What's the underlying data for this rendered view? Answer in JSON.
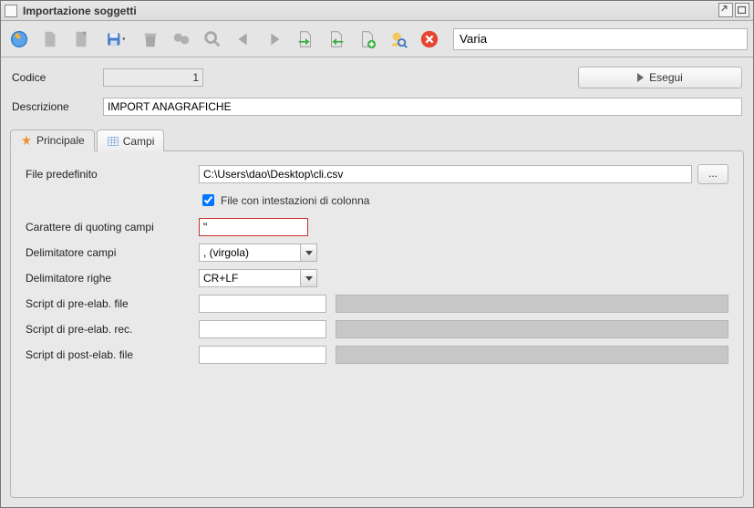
{
  "window": {
    "title": "Importazione soggetti"
  },
  "toolbar": {
    "search_value": "Varia"
  },
  "form": {
    "codice_label": "Codice",
    "codice_value": "1",
    "esegui_label": "Esegui",
    "descrizione_label": "Descrizione",
    "descrizione_value": "IMPORT ANAGRAFICHE"
  },
  "tabs": {
    "principale": "Principale",
    "campi": "Campi"
  },
  "principale": {
    "file_predefinito_label": "File predefinito",
    "file_predefinito_value": "C:\\Users\\dao\\Desktop\\cli.csv",
    "browse_label": "...",
    "checkbox_label": "File con intestazioni di colonna",
    "checkbox_checked": true,
    "carattere_label": "Carattere di quoting campi",
    "carattere_value": "\"",
    "delimitatore_campi_label": "Delimitatore campi",
    "delimitatore_campi_value": ", (virgola)",
    "delimitatore_righe_label": "Delimitatore righe",
    "delimitatore_righe_value": "CR+LF",
    "script_pre_file_label": "Script di pre-elab. file",
    "script_pre_file_value": "",
    "script_pre_rec_label": "Script di pre-elab. rec.",
    "script_pre_rec_value": "",
    "script_post_file_label": "Script di post-elab. file",
    "script_post_file_value": ""
  }
}
